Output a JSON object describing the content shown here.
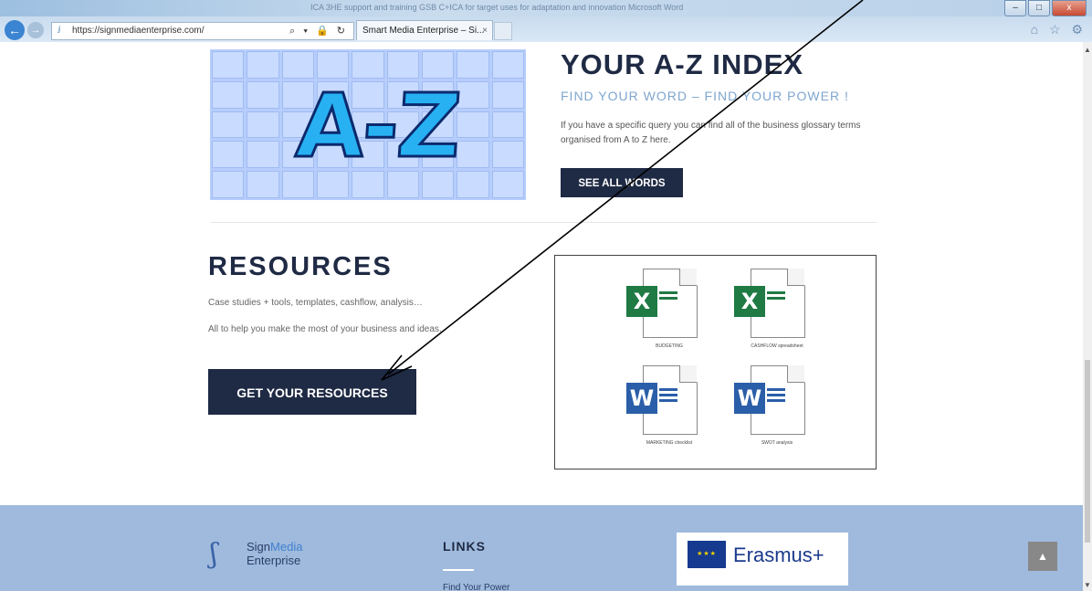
{
  "browser": {
    "window_title": "ICA 3HE support and training GSB C+ICA for target uses for adaptation and innovation Microsoft Word",
    "url": "https://signmediaenterprise.com/",
    "tab_title": "Smart Media Enterprise – Si...",
    "tab_close": "×",
    "window_buttons": {
      "minimize": "–",
      "maximize": "□",
      "close": "x"
    },
    "addr_tools": "⌕ ▾ 🔒 ↻",
    "toolbar_icons": "⌂ ☆ ⚙"
  },
  "az_section": {
    "image_text": "A-Z",
    "title": "YOUR A-Z INDEX",
    "subtitle": "FIND YOUR WORD – FIND YOUR POWER !",
    "description": "If you have a specific query you can find all of the business glossary terms organised from A to Z here.",
    "button": "SEE ALL WORDS"
  },
  "resources_section": {
    "title": "RESOURCES",
    "line1": "Case studies + tools, templates, cashflow, analysis…",
    "line2": "All to help you make the most of your business and ideas.",
    "button": "GET YOUR RESOURCES",
    "files": [
      {
        "badge": "X",
        "type": "excel",
        "caption": "BUDGETING"
      },
      {
        "badge": "X",
        "type": "excel",
        "caption": "CASHFLOW spreadsheet"
      },
      {
        "badge": "W",
        "type": "word",
        "caption": "MARKETING checklist"
      },
      {
        "badge": "W",
        "type": "word",
        "caption": "SWOT analysis"
      }
    ]
  },
  "footer": {
    "logo_sign": "Sign",
    "logo_media": "Media",
    "logo_enterprise": "Enterprise",
    "links_title": "LINKS",
    "links_item": "Find Your Power",
    "erasmus": "Erasmus+",
    "eu_stars": "★★★",
    "to_top": "▲"
  },
  "scrollbar": {
    "up": "▲",
    "down": "▼"
  },
  "colors": {
    "dark_navy": "#1f2a44",
    "footer_blue": "#9fbadd",
    "subtitle_blue": "#7fa6cf"
  }
}
